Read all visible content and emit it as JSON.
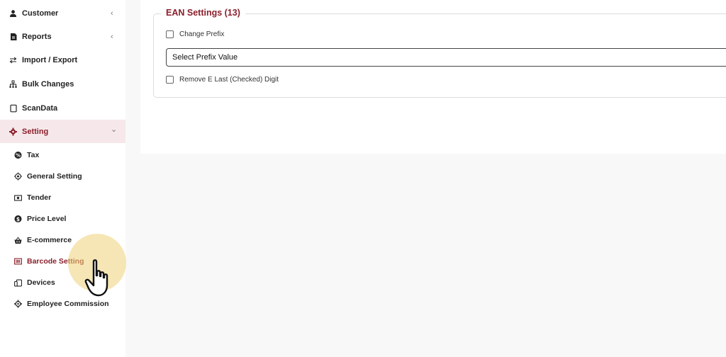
{
  "sidebar": {
    "items": [
      {
        "label": "Customer",
        "icon": "user-icon",
        "chevron": "‹"
      },
      {
        "label": "Reports",
        "icon": "report-icon",
        "chevron": "‹"
      },
      {
        "label": "Import / Export",
        "icon": "transfer-icon"
      },
      {
        "label": "Bulk Changes",
        "icon": "hierarchy-icon"
      },
      {
        "label": "ScanData",
        "icon": "document-icon"
      },
      {
        "label": "Setting",
        "icon": "gear-icon",
        "chevron": "⌄"
      }
    ],
    "sub_items": [
      {
        "label": "Tax",
        "icon": "tax-icon"
      },
      {
        "label": "General Setting",
        "icon": "target-icon"
      },
      {
        "label": "Tender",
        "icon": "cash-icon"
      },
      {
        "label": "Price Level",
        "icon": "dollar-icon"
      },
      {
        "label": "E-commerce",
        "icon": "basket-icon"
      },
      {
        "label": "Barcode Setting",
        "icon": "barcode-icon"
      },
      {
        "label": "Devices",
        "icon": "devices-icon"
      },
      {
        "label": "Employee Commission",
        "icon": "cog-icon"
      }
    ],
    "accent_color": "#8a1f2b"
  },
  "ean": {
    "title": "EAN Settings (13)",
    "change_prefix_label": "Change Prefix",
    "select_placeholder": "Select Prefix Value",
    "remove_digit_label": "Remove E Last (Checked) Digit"
  }
}
